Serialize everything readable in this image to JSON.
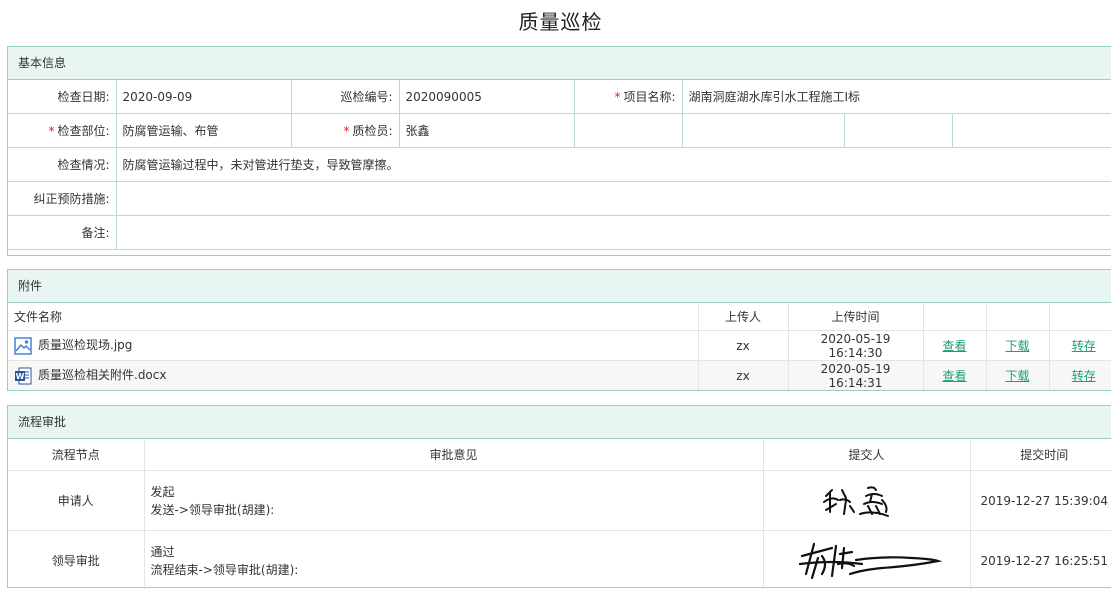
{
  "page": {
    "title": "质量巡检"
  },
  "basic": {
    "header": "基本信息",
    "check_date_label": "检查日期:",
    "check_date": "2020-09-09",
    "patrol_no_label": "巡检编号:",
    "patrol_no": "2020090005",
    "project_label": "项目名称:",
    "project": "湖南洞庭湖水库引水工程施工I标",
    "part_label": "检查部位:",
    "part": "防腐管运输、布管",
    "inspector_label": "质检员:",
    "inspector": "张鑫",
    "situation_label": "检查情况:",
    "situation": "防腐管运输过程中，未对管进行垫支，导致管摩擦。",
    "measures_label": "纠正预防措施:",
    "measures": "",
    "remark_label": "备注:",
    "remark": "",
    "required_mark": "*"
  },
  "attachments": {
    "header": "附件",
    "columns": {
      "name": "文件名称",
      "uploader": "上传人",
      "time": "上传时间"
    },
    "files": [
      {
        "name": "质量巡检现场.jpg",
        "icon": "image-file-icon",
        "uploader": "zx",
        "time": "2020-05-19 16:14:30",
        "view": "查看",
        "download": "下载",
        "transfer": "转存"
      },
      {
        "name": "质量巡检相关附件.docx",
        "icon": "word-file-icon",
        "uploader": "zx",
        "time": "2020-05-19 16:14:31",
        "view": "查看",
        "download": "下载",
        "transfer": "转存"
      }
    ]
  },
  "approval": {
    "header": "流程审批",
    "columns": {
      "node": "流程节点",
      "opinion": "审批意见",
      "submitter": "提交人",
      "time": "提交时间"
    },
    "rows": [
      {
        "node": "申请人",
        "opinion": "发起",
        "flow": "发送->领导审批(胡建):",
        "submitter_signature": "张鑫",
        "time": "2019-12-27 15:39:04"
      },
      {
        "node": "领导审批",
        "opinion": "通过",
        "flow": "流程结束->领导审批(胡建):",
        "submitter_signature": "胡建",
        "time": "2019-12-27 16:25:51"
      }
    ]
  }
}
